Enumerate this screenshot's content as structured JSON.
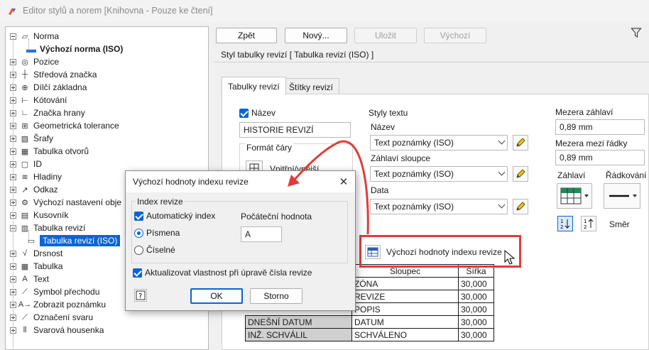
{
  "window": {
    "title": "Editor stylů a norem [Knihovna - Pouze ke čtení]"
  },
  "tree": {
    "items": [
      {
        "label": "Norma",
        "icon": "norm-icon",
        "bold": false
      },
      {
        "label": "Výchozí norma (ISO)",
        "icon": "default-norm-icon",
        "bold": true
      },
      {
        "label": "Pozice",
        "icon": "balloon-icon"
      },
      {
        "label": "Středová značka",
        "icon": "center-mark-icon"
      },
      {
        "label": "Dílčí základna",
        "icon": "datum-target-icon"
      },
      {
        "label": "Kótování",
        "icon": "dimension-icon"
      },
      {
        "label": "Značka hrany",
        "icon": "edge-symbol-icon"
      },
      {
        "label": "Geometrická tolerance",
        "icon": "feature-control-frame-icon"
      },
      {
        "label": "Šrafy",
        "icon": "hatch-icon"
      },
      {
        "label": "Tabulka otvorů",
        "icon": "hole-table-icon"
      },
      {
        "label": "ID",
        "icon": "id-icon"
      },
      {
        "label": "Hladiny",
        "icon": "layers-icon"
      },
      {
        "label": "Odkaz",
        "icon": "leader-icon"
      },
      {
        "label": "Výchozí nastavení obje",
        "icon": "object-defaults-icon"
      },
      {
        "label": "Kusovník",
        "icon": "parts-list-icon"
      },
      {
        "label": "Tabulka revizí",
        "icon": "revision-table-icon"
      },
      {
        "label": "Tabulka revizí (ISO)",
        "icon": "revision-table-iso-icon",
        "selected": true
      },
      {
        "label": "Drsnost",
        "icon": "surface-texture-icon"
      },
      {
        "label": "Tabulka",
        "icon": "table-icon"
      },
      {
        "label": "Text",
        "icon": "text-icon"
      },
      {
        "label": "Symbol přechodu",
        "icon": "taper-symbol-icon"
      },
      {
        "label": "Zobrazit poznámku",
        "icon": "view-annotation-icon"
      },
      {
        "label": "Označení svaru",
        "icon": "weld-symbol-icon"
      },
      {
        "label": "Svarová housenka",
        "icon": "weld-bead-icon"
      }
    ]
  },
  "toolbar": {
    "back": "Zpět",
    "new": "Nový...",
    "save": "Uložit",
    "reset": "Výchozí"
  },
  "style_header": "Styl tabulky revizí [ Tabulka revizí (ISO) ]",
  "tabs": [
    "Tabulky revizí",
    "Štítky revizí"
  ],
  "form": {
    "title_checkbox": "Název",
    "title_value": "HISTORIE REVIZÍ",
    "line_format": "Formát čáry",
    "line_format_option": "Vnitřní/vnější",
    "text_styles": "Styly textu",
    "title_label": "Název",
    "title_style": "Text poznámky (ISO)",
    "column_header_label": "Záhlaví sloupce",
    "column_header_style": "Text poznámky (ISO)",
    "data_label": "Data",
    "data_style": "Text poznámky (ISO)",
    "header_gap_label": "Mezera záhlaví",
    "header_gap_value": "0,89 mm",
    "row_gap_label": "Mezera mezi řádky",
    "row_gap_value": "0,89 mm",
    "header_label": "Záhlaví",
    "lines_label": "Řádkování",
    "direction_label": "Směr",
    "index_defaults_button": "Výchozí hodnoty indexu revize"
  },
  "rev_table": {
    "headers": [
      "",
      "Sloupec",
      "Šířka"
    ],
    "rows": [
      [
        "",
        "ZÓNA",
        "30,000"
      ],
      [
        "",
        "REVIZE",
        "30,000"
      ],
      [
        "",
        "POPIS",
        "30,000"
      ],
      [
        "DNEŠNÍ DATUM",
        "DATUM",
        "30,000"
      ],
      [
        "INŽ. SCHVÁLIL",
        "SCHVÁLENO",
        "30,000"
      ]
    ]
  },
  "dialog": {
    "title": "Výchozí hodnoty indexu revize",
    "group_label": "Index revize",
    "auto_index": "Automatický index",
    "letters": "Písmena",
    "numeric": "Číselné",
    "start_value_label": "Počáteční hodnota",
    "start_value": "A",
    "update_props": "Aktualizovat vlastnost při úpravě čísla revize",
    "ok": "OK",
    "cancel": "Storno"
  },
  "colors": {
    "accent": "#0a64d6",
    "callout": "#e03c3c"
  }
}
